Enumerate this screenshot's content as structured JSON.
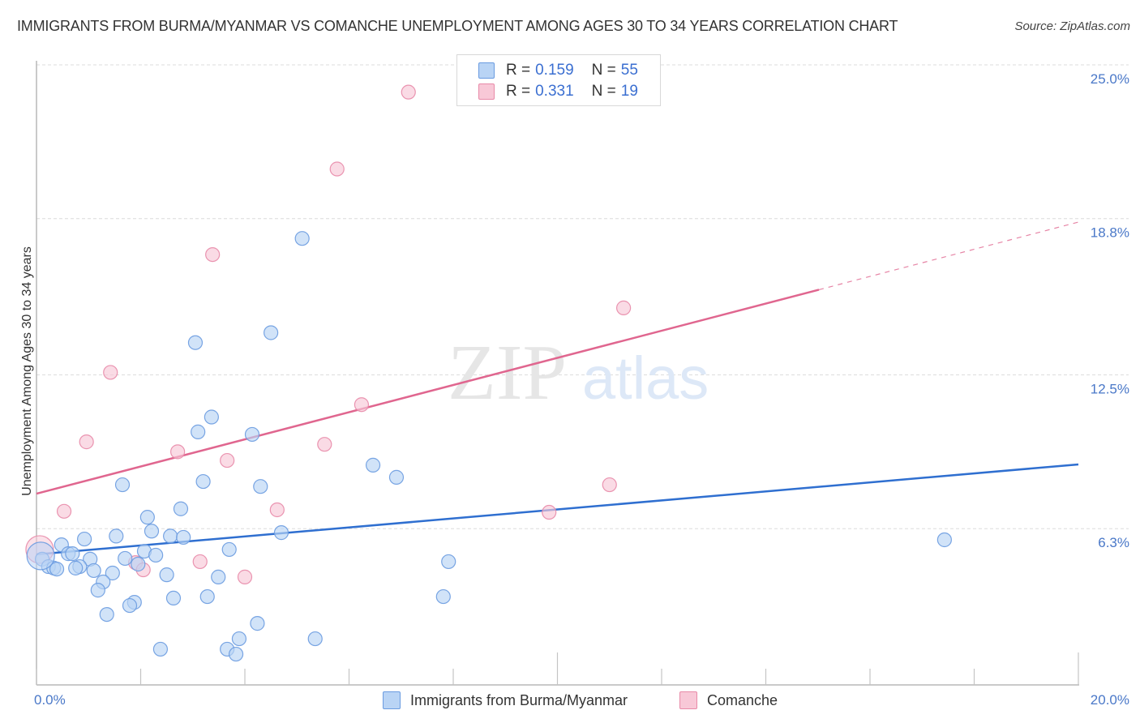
{
  "header": {
    "title": "IMMIGRANTS FROM BURMA/MYANMAR VS COMANCHE UNEMPLOYMENT AMONG AGES 30 TO 34 YEARS CORRELATION CHART",
    "source": "Source: ZipAtlas.com"
  },
  "watermark": {
    "zip": "ZIP",
    "atlas": "atlas"
  },
  "legend": {
    "rows": [
      {
        "r_label": "R = ",
        "r_value": "0.159",
        "n_label": "N = ",
        "n_value": "55",
        "color": "#b9d4f5",
        "border": "#6a9be0"
      },
      {
        "r_label": "R = ",
        "r_value": "0.331",
        "n_label": "N = ",
        "n_value": "19",
        "color": "#f8c8d7",
        "border": "#e88aa8"
      }
    ]
  },
  "bottom_legend": {
    "items": [
      {
        "label": "Immigrants from Burma/Myanmar",
        "color": "#b9d4f5",
        "border": "#6a9be0"
      },
      {
        "label": "Comanche",
        "color": "#f8c8d7",
        "border": "#e88aa8"
      }
    ]
  },
  "chart_data": {
    "type": "scatter",
    "title": "IMMIGRANTS FROM BURMA/MYANMAR VS COMANCHE UNEMPLOYMENT AMONG AGES 30 TO 34 YEARS CORRELATION CHART",
    "xlabel": "",
    "ylabel": "Unemployment Among Ages 30 to 34 years",
    "xlim": [
      0,
      20
    ],
    "ylim": [
      0,
      25
    ],
    "x_tick_labels": [
      {
        "value": 0,
        "label": "0.0%"
      },
      {
        "value": 20,
        "label": "20.0%"
      }
    ],
    "y_tick_labels": [
      {
        "value": 6.3,
        "label": "6.3%"
      },
      {
        "value": 12.5,
        "label": "12.5%"
      },
      {
        "value": 18.8,
        "label": "18.8%"
      },
      {
        "value": 25.0,
        "label": "25.0%"
      }
    ],
    "x_minor_ticks": [
      0,
      2,
      4,
      6,
      8,
      10,
      12,
      14,
      16,
      18,
      20
    ],
    "grid": "horizontal-dashed",
    "legend_position": "top-center",
    "series": [
      {
        "name": "Immigrants from Burma/Myanmar",
        "color": "#6a9be0",
        "fill": "#b9d4f5",
        "line_color": "#2f6fd0",
        "R": 0.159,
        "N": 55,
        "trend": {
          "x": [
            0,
            20
          ],
          "y": [
            5.26,
            8.89
          ],
          "dashed_from": null
        },
        "points": [
          [
            5.1,
            18.0
          ],
          [
            4.5,
            14.2
          ],
          [
            3.05,
            13.8
          ],
          [
            3.36,
            10.8
          ],
          [
            3.1,
            10.2
          ],
          [
            4.14,
            10.1
          ],
          [
            6.46,
            8.86
          ],
          [
            6.91,
            8.37
          ],
          [
            3.2,
            8.2
          ],
          [
            1.65,
            8.07
          ],
          [
            4.3,
            8.0
          ],
          [
            2.77,
            7.1
          ],
          [
            2.13,
            6.76
          ],
          [
            2.21,
            6.2
          ],
          [
            4.7,
            6.14
          ],
          [
            1.53,
            6.0
          ],
          [
            2.57,
            6.0
          ],
          [
            2.82,
            5.95
          ],
          [
            0.92,
            5.88
          ],
          [
            17.43,
            5.85
          ],
          [
            0.48,
            5.65
          ],
          [
            3.7,
            5.46
          ],
          [
            2.07,
            5.39
          ],
          [
            0.61,
            5.29
          ],
          [
            0.69,
            5.29
          ],
          [
            1.7,
            5.1
          ],
          [
            2.29,
            5.23
          ],
          [
            1.03,
            5.07
          ],
          [
            7.91,
            4.97
          ],
          [
            0.11,
            5.07
          ],
          [
            1.95,
            4.87
          ],
          [
            0.23,
            4.77
          ],
          [
            0.33,
            4.71
          ],
          [
            0.39,
            4.67
          ],
          [
            0.83,
            4.77
          ],
          [
            0.75,
            4.71
          ],
          [
            1.1,
            4.61
          ],
          [
            1.46,
            4.51
          ],
          [
            2.5,
            4.44
          ],
          [
            3.49,
            4.35
          ],
          [
            1.28,
            4.15
          ],
          [
            1.18,
            3.82
          ],
          [
            2.63,
            3.5
          ],
          [
            3.28,
            3.56
          ],
          [
            7.81,
            3.56
          ],
          [
            1.88,
            3.33
          ],
          [
            1.79,
            3.2
          ],
          [
            1.35,
            2.84
          ],
          [
            4.24,
            2.48
          ],
          [
            3.89,
            1.86
          ],
          [
            5.35,
            1.86
          ],
          [
            2.38,
            1.44
          ],
          [
            3.66,
            1.44
          ],
          [
            3.83,
            1.24
          ],
          [
            0.05,
            5.2
          ]
        ]
      },
      {
        "name": "Comanche",
        "color": "#e88aa8",
        "fill": "#f8c8d7",
        "line_color": "#e0668f",
        "R": 0.331,
        "N": 19,
        "trend": {
          "x": [
            0,
            20
          ],
          "y": [
            7.71,
            18.66
          ],
          "dashed_from": 15.02
        },
        "points": [
          [
            7.14,
            23.9
          ],
          [
            5.77,
            20.8
          ],
          [
            3.38,
            17.35
          ],
          [
            11.27,
            15.2
          ],
          [
            1.42,
            12.6
          ],
          [
            6.24,
            11.3
          ],
          [
            0.96,
            9.8
          ],
          [
            5.53,
            9.7
          ],
          [
            2.71,
            9.4
          ],
          [
            3.66,
            9.05
          ],
          [
            11.0,
            8.07
          ],
          [
            0.53,
            7.0
          ],
          [
            4.62,
            7.06
          ],
          [
            9.84,
            6.96
          ],
          [
            3.14,
            4.97
          ],
          [
            1.9,
            4.93
          ],
          [
            2.05,
            4.64
          ],
          [
            4.0,
            4.35
          ],
          [
            0.03,
            5.46
          ]
        ]
      }
    ]
  }
}
